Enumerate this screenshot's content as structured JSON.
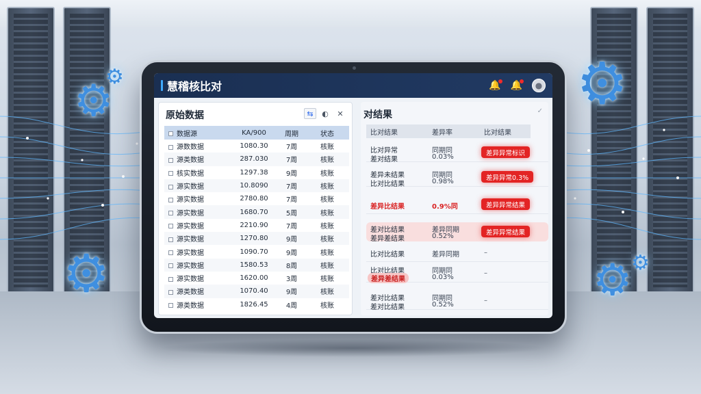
{
  "app": {
    "title": "慧稽核比对"
  },
  "topbar_icons": {
    "bell": "bell-icon",
    "alert": "alert-bell-icon",
    "user": "user-avatar-icon"
  },
  "left_panel": {
    "title": "原始数据",
    "tools": [
      "sync-icon",
      "refresh-icon",
      "close-icon"
    ],
    "headers": [
      "数据源",
      "KA/900",
      "周期",
      "状态"
    ],
    "rows": [
      [
        "源数数据",
        "1080.30",
        "7周",
        "核账"
      ],
      [
        "源类数据",
        "287.030",
        "7周",
        "核账"
      ],
      [
        "核实数据",
        "1297.38",
        "9周",
        "核账"
      ],
      [
        "源实数据",
        "10.8090",
        "7周",
        "核账"
      ],
      [
        "源实数据",
        "2780.80",
        "7周",
        "核账"
      ],
      [
        "源实数据",
        "1680.70",
        "5周",
        "核账"
      ],
      [
        "源实数据",
        "2210.90",
        "7周",
        "核账"
      ],
      [
        "源实数据",
        "1270.80",
        "9周",
        "核账"
      ],
      [
        "源实数据",
        "1090.70",
        "9周",
        "核账"
      ],
      [
        "源实数据",
        "1580.53",
        "8周",
        "核账"
      ],
      [
        "源实数据",
        "1620.00",
        "3周",
        "核账"
      ],
      [
        "源类数据",
        "1070.40",
        "9周",
        "核账"
      ],
      [
        "源类数据",
        "1826.45",
        "4周",
        "核账"
      ]
    ]
  },
  "right_panel": {
    "title": "对结果",
    "headers": [
      "比对结果",
      "差异率",
      "比对结果"
    ],
    "rows": [
      {
        "l1": "比对异常",
        "l2": "差对结果",
        "v1": "同期同",
        "v2": "0.03%",
        "tag": "badge",
        "tag_text": "差异异常标识",
        "highlight": false,
        "red_l1": false,
        "red_v": false
      },
      {
        "l1": "差异未结果",
        "l2": "比对比结果",
        "v1": "同期同",
        "v2": "0.98%",
        "tag": "badge",
        "tag_text": "差异异常0.3%",
        "highlight": false,
        "red_l1": false,
        "red_v": false
      },
      {
        "l1": "差异比结果",
        "l2": "",
        "v1": "0.9%同",
        "v2": "",
        "tag": "badge",
        "tag_text": "差异异常结果",
        "highlight": false,
        "red_l1": true,
        "red_v": true
      },
      {
        "l1": "差对比结果",
        "l2": "差异差结果",
        "v1": "差异同期",
        "v2": "0.52%",
        "tag": "badge",
        "tag_text": "差异异常结果",
        "highlight": true,
        "red_l1": false,
        "red_v": false
      },
      {
        "l1": "比对比结果",
        "l2": "",
        "v1": "差异同期",
        "v2": "",
        "tag": "dash",
        "tag_text": "–",
        "highlight": false,
        "red_l1": false,
        "red_v": false
      },
      {
        "l1": "比对比结果",
        "l2": "差异差结果",
        "v1": "同期同",
        "v2": "0.03%",
        "tag": "dash",
        "tag_text": "–",
        "highlight": false,
        "red_l1": false,
        "red_v": false,
        "pill_l2": true
      },
      {
        "l1": "差对比结果",
        "l2": "差对比结果",
        "v1": "同期同",
        "v2": "0.52%",
        "tag": "dash",
        "tag_text": "–",
        "highlight": false,
        "red_l1": false,
        "red_v": false
      }
    ]
  },
  "colors": {
    "topbar": "#1a2f52",
    "accent": "#3fa9ff",
    "alert_red": "#e32424",
    "header_blue": "#c9d9ee"
  }
}
